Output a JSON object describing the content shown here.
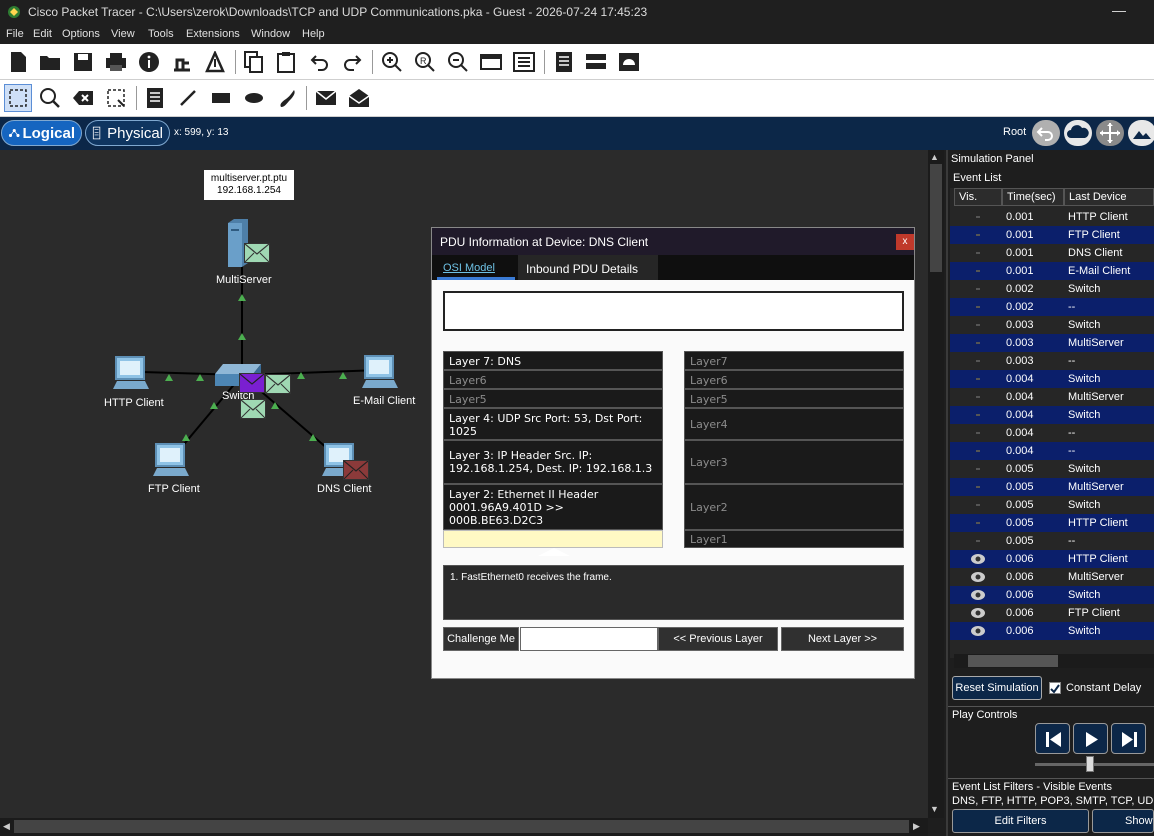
{
  "window": {
    "title": "Cisco Packet Tracer - C:\\Users\\zerok\\Downloads\\TCP and UDP Communications.pka - Guest - 2026-07-24 17:45:23",
    "minimize": "—"
  },
  "menu": [
    "File",
    "Edit",
    "Options",
    "View",
    "Tools",
    "Extensions",
    "Window",
    "Help"
  ],
  "toolbar1": [
    "new-file-icon",
    "open-folder-icon",
    "save-icon",
    "print-icon",
    "info-icon",
    "network-wizard-icon",
    "activity-wizard-icon",
    "copy-icon",
    "paste-icon",
    "undo-icon",
    "redo-icon",
    "zoom-in-icon",
    "zoom-reset-icon",
    "zoom-out-icon",
    "drawing-palette-icon",
    "custom-device-icon",
    "notes-icon",
    "device-list-icon",
    "cluster-icon"
  ],
  "toolbar2": [
    "select-icon",
    "inspect-icon",
    "delete-icon",
    "resize-icon",
    "note-icon",
    "line-icon",
    "rectangle-icon",
    "ellipse-icon",
    "freeform-icon",
    "simple-pdu-icon",
    "complex-pdu-icon"
  ],
  "viewbar": {
    "logical": "Logical",
    "physical": "Physical",
    "coords": "x: 599, y: 13",
    "root": "Root"
  },
  "topology": {
    "server_tooltip": {
      "line1": "multiserver.pt.ptu",
      "line2": "192.168.1.254"
    },
    "devices": {
      "multiserver": "MultiServer",
      "switch": "Switch",
      "http": "HTTP Client",
      "email": "E-Mail Client",
      "ftp": "FTP Client",
      "dns": "DNS Client"
    }
  },
  "pdu": {
    "title": "PDU Information at Device: DNS Client",
    "close": "x",
    "tab_osi": "OSI Model",
    "tab_inbound": "Inbound PDU Details",
    "in_layers": [
      "Layer 7: DNS",
      "Layer6",
      "Layer5",
      "Layer 4: UDP Src Port: 53, Dst Port: 1025",
      "Layer 3: IP Header Src. IP: 192.168.1.254, Dest. IP: 192.168.1.3",
      "Layer 2: Ethernet II Header 0001.96A9.401D >> 000B.BE63.D2C3",
      "Layer 1: Port FastEthernet0"
    ],
    "out_layers": [
      "Layer7",
      "Layer6",
      "Layer5",
      "Layer4",
      "Layer3",
      "Layer2",
      "Layer1"
    ],
    "description": "1. FastEthernet0 receives the frame.",
    "challenge": "Challenge Me",
    "prev": "<< Previous Layer",
    "next": "Next Layer >>"
  },
  "sim": {
    "panel_title": "Simulation Panel",
    "event_list": "Event List",
    "col_vis": "Vis.",
    "col_time": "Time(sec)",
    "col_last": "Last Device",
    "events": [
      {
        "time": "0.001",
        "last": "HTTP Client",
        "vis": false
      },
      {
        "time": "0.001",
        "last": "FTP Client",
        "vis": false
      },
      {
        "time": "0.001",
        "last": "DNS Client",
        "vis": false
      },
      {
        "time": "0.001",
        "last": "E-Mail Client",
        "vis": false
      },
      {
        "time": "0.002",
        "last": "Switch",
        "vis": false
      },
      {
        "time": "0.002",
        "last": "--",
        "vis": false
      },
      {
        "time": "0.003",
        "last": "Switch",
        "vis": false
      },
      {
        "time": "0.003",
        "last": "MultiServer",
        "vis": false
      },
      {
        "time": "0.003",
        "last": "--",
        "vis": false
      },
      {
        "time": "0.004",
        "last": "Switch",
        "vis": false
      },
      {
        "time": "0.004",
        "last": "MultiServer",
        "vis": false
      },
      {
        "time": "0.004",
        "last": "Switch",
        "vis": false
      },
      {
        "time": "0.004",
        "last": "--",
        "vis": false
      },
      {
        "time": "0.004",
        "last": "--",
        "vis": false
      },
      {
        "time": "0.005",
        "last": "Switch",
        "vis": false
      },
      {
        "time": "0.005",
        "last": "MultiServer",
        "vis": false
      },
      {
        "time": "0.005",
        "last": "Switch",
        "vis": false
      },
      {
        "time": "0.005",
        "last": "HTTP Client",
        "vis": false
      },
      {
        "time": "0.005",
        "last": "--",
        "vis": false
      },
      {
        "time": "0.006",
        "last": "HTTP Client",
        "vis": true
      },
      {
        "time": "0.006",
        "last": "MultiServer",
        "vis": true
      },
      {
        "time": "0.006",
        "last": "Switch",
        "vis": true
      },
      {
        "time": "0.006",
        "last": "FTP Client",
        "vis": true
      },
      {
        "time": "0.006",
        "last": "Switch",
        "vis": true
      }
    ],
    "reset": "Reset Simulation",
    "constant_delay": "Constant Delay",
    "play_controls": "Play Controls",
    "filters_title": "Event List Filters - Visible Events",
    "filters_list": "DNS, FTP, HTTP, POP3, SMTP, TCP, UDP",
    "edit_filters": "Edit Filters",
    "show": "Show"
  },
  "colors": {
    "accent": "#0c2748",
    "row_highlight": "#0b1f6b",
    "link_green": "#4caf50",
    "pdu_green": "#9fd8b3",
    "pdu_purple": "#7a1fd1",
    "pdu_red": "#8b3a3a"
  }
}
